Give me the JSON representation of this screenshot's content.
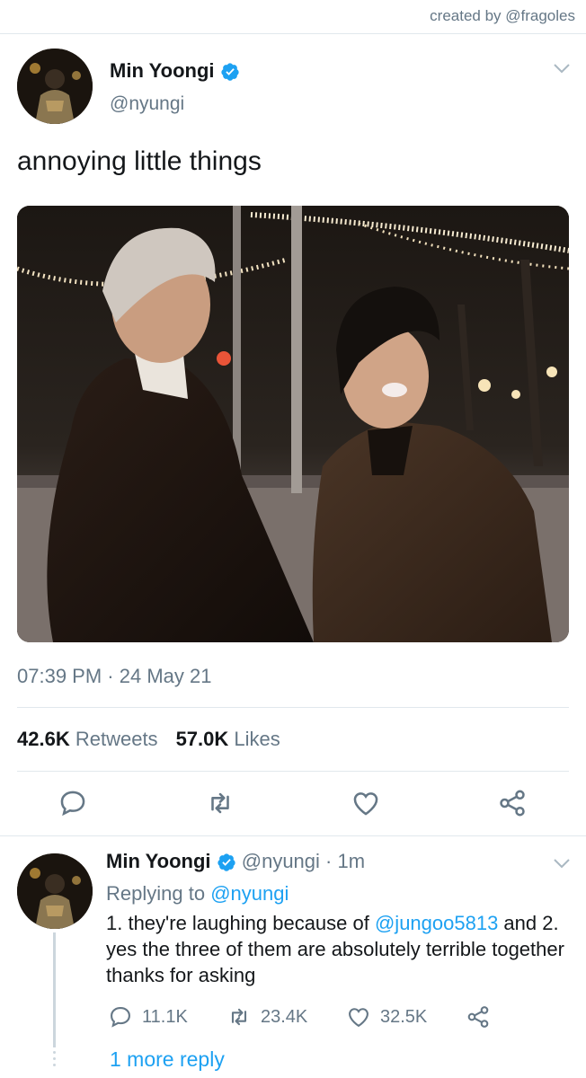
{
  "credit": "created by @fragoles",
  "tweet": {
    "author_name": "Min Yoongi",
    "author_handle": "@nyungi",
    "text": "annoying little things",
    "time": "07:39 PM",
    "date": "24 May 21",
    "retweets_count": "42.6K",
    "retweets_label": "Retweets",
    "likes_count": "57.0K",
    "likes_label": "Likes"
  },
  "reply": {
    "author_name": "Min Yoongi",
    "author_handle": "@nyungi",
    "time_ago": "1m",
    "replying_to_label": "Replying to",
    "replying_to_handle": "@nyungi",
    "body_part1": "1. they're laughing because of ",
    "body_mention": "@jungoo5813",
    "body_part2": " and 2. yes the three of them are absolutely terrible together thanks for asking",
    "replies_count": "11.1K",
    "retweets_count": "23.4K",
    "likes_count": "32.5K",
    "more_replies": "1 more reply"
  },
  "colors": {
    "accent": "#1da1f2",
    "muted": "#657786",
    "text": "#14171a",
    "divider": "#e1e8ed"
  },
  "icons": [
    "verified-badge-icon",
    "chevron-down-icon",
    "reply-icon",
    "retweet-icon",
    "like-icon",
    "share-icon"
  ]
}
